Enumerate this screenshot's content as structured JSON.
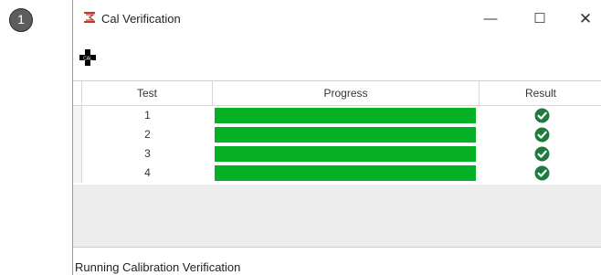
{
  "badge": {
    "number": "1"
  },
  "window": {
    "title": "Cal Verification",
    "controls": {
      "minimize": "—",
      "maximize": "☐",
      "close": "✕"
    }
  },
  "toolbar": {
    "cal_icon_text": "CAL"
  },
  "grid": {
    "columns": [
      "Test",
      "Progress",
      "Result"
    ],
    "rows": [
      {
        "test": "1",
        "progress": 1.0,
        "result": "pass"
      },
      {
        "test": "2",
        "progress": 1.0,
        "result": "pass"
      },
      {
        "test": "3",
        "progress": 1.0,
        "result": "pass"
      },
      {
        "test": "4",
        "progress": 1.0,
        "result": "pass"
      }
    ]
  },
  "colors": {
    "progress_fill": "#06b025",
    "pass_check": "#1f7a3d"
  },
  "status": {
    "text": "Running Calibration Verification"
  }
}
